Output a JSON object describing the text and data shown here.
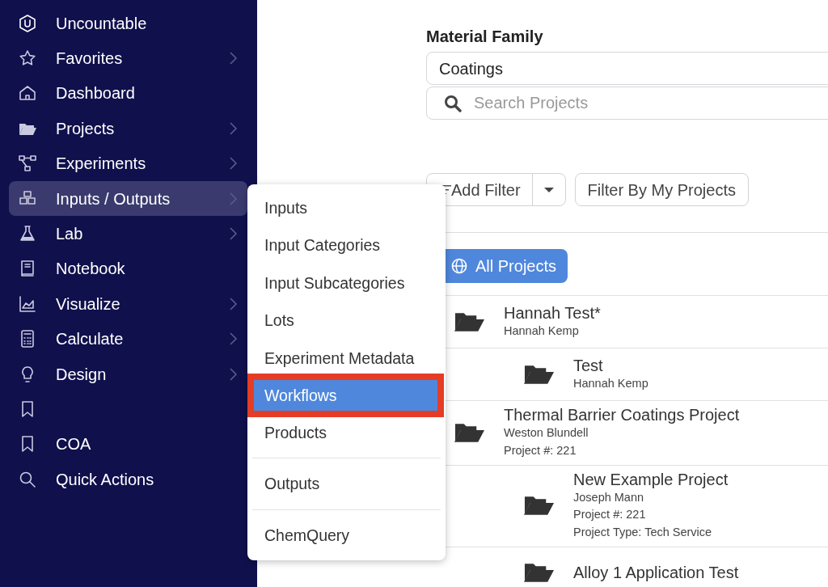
{
  "sidebar": {
    "items": [
      {
        "label": "Uncountable",
        "submenu": false,
        "active": false
      },
      {
        "label": "Favorites",
        "submenu": true,
        "active": false
      },
      {
        "label": "Dashboard",
        "submenu": false,
        "active": false
      },
      {
        "label": "Projects",
        "submenu": true,
        "active": false
      },
      {
        "label": "Experiments",
        "submenu": true,
        "active": false
      },
      {
        "label": "Inputs / Outputs",
        "submenu": true,
        "active": true
      },
      {
        "label": "Lab",
        "submenu": true,
        "active": false
      },
      {
        "label": "Notebook",
        "submenu": false,
        "active": false
      },
      {
        "label": "Visualize",
        "submenu": true,
        "active": false
      },
      {
        "label": "Calculate",
        "submenu": true,
        "active": false
      },
      {
        "label": "Design",
        "submenu": true,
        "active": false
      },
      {
        "submenu": false,
        "active": false
      },
      {
        "label": "COA",
        "submenu": false,
        "active": false
      },
      {
        "label": "Quick Actions",
        "submenu": false,
        "active": false
      }
    ]
  },
  "submenu": {
    "groups": [
      [
        {
          "label": "Inputs",
          "selected": false
        },
        {
          "label": "Input Categories",
          "selected": false
        },
        {
          "label": "Input Subcategories",
          "selected": false
        },
        {
          "label": "Lots",
          "selected": false
        },
        {
          "label": "Experiment Metadata",
          "selected": false
        },
        {
          "label": "Workflows",
          "selected": true
        },
        {
          "label": "Products",
          "selected": false
        }
      ],
      [
        {
          "label": "Outputs",
          "selected": false
        }
      ],
      [
        {
          "label": "ChemQuery",
          "selected": false
        }
      ]
    ]
  },
  "main": {
    "material_family": {
      "label": "Material Family",
      "value": "Coatings"
    },
    "search": {
      "placeholder": "Search Projects"
    },
    "add_filter": "Add Filter",
    "filter_mine": "Filter By My Projects",
    "all_projects": "All Projects",
    "projects": [
      {
        "title": "Hannah Test*",
        "lines": [
          "Hannah Kemp"
        ],
        "children": [
          {
            "title": "Test",
            "lines": [
              "Hannah Kemp"
            ]
          }
        ]
      },
      {
        "title": "Thermal Barrier Coatings Project",
        "lines": [
          "Weston Blundell",
          "Project #: 221"
        ],
        "children": [
          {
            "title": "New Example Project",
            "lines": [
              "Joseph Mann",
              "Project #: 221",
              "Project Type: Tech Service"
            ]
          },
          {
            "title": "Alloy 1 Application Test"
          }
        ]
      }
    ]
  }
}
